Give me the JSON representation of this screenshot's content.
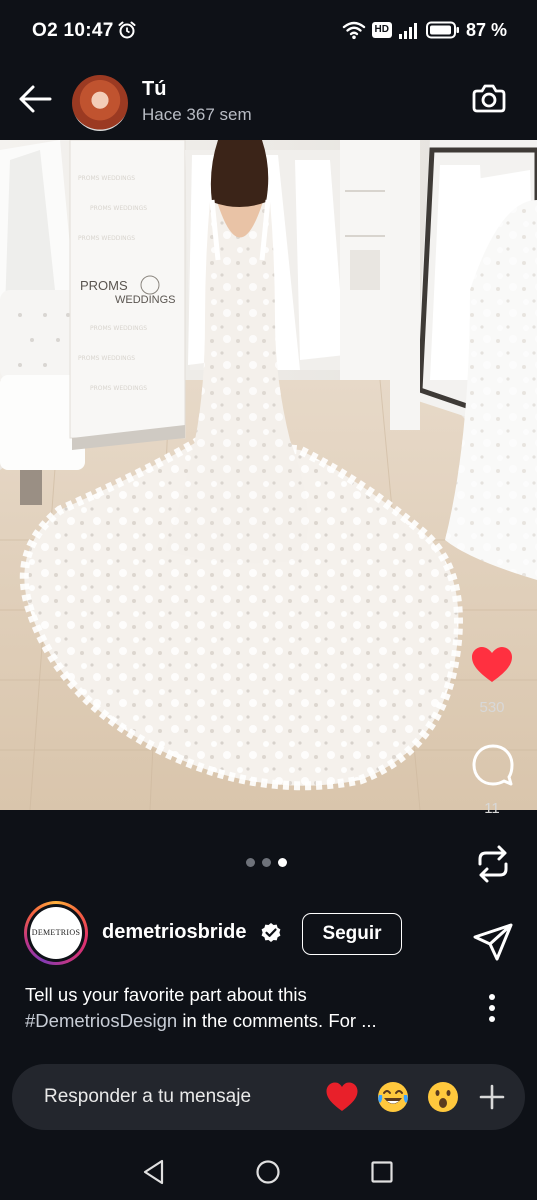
{
  "status_bar": {
    "time": "O2 10:47",
    "hd_badge": "HD",
    "battery": "87 %",
    "icons": [
      "alarm-icon",
      "wifi-icon",
      "cellular-signal-icon",
      "battery-icon"
    ]
  },
  "header": {
    "username": "Tú",
    "timestamp": "Hace 367 sem",
    "icons": [
      "back-arrow-icon",
      "camera-icon"
    ]
  },
  "photo": {
    "banner_line1": "PROMS",
    "banner_line2": "WEDDINGS"
  },
  "actions": {
    "like_count": "530",
    "comment_count": "11",
    "like_color": "#ff3040",
    "icons": [
      "heart-icon",
      "comment-icon",
      "repost-icon",
      "share-icon",
      "more-vertical-icon"
    ]
  },
  "carousel": {
    "total": 3,
    "active_index": 2
  },
  "post": {
    "account_name": "demetriosbride",
    "avatar_text": "DEMETRIOS",
    "follow_label": "Seguir",
    "caption_line1": "Tell us your favorite part about this",
    "caption_hashtag": "#DemetriosDesign",
    "caption_rest": " in the comments. For ..."
  },
  "reply_bar": {
    "placeholder": "Responder a tu mensaje",
    "quick_reactions": [
      "heart-emoji",
      "laughing-tears-emoji",
      "surprised-emoji"
    ],
    "icons": [
      "plus-icon"
    ]
  },
  "nav_bar": {
    "icons": [
      "back-triangle-icon",
      "home-circle-icon",
      "recents-square-icon"
    ]
  }
}
